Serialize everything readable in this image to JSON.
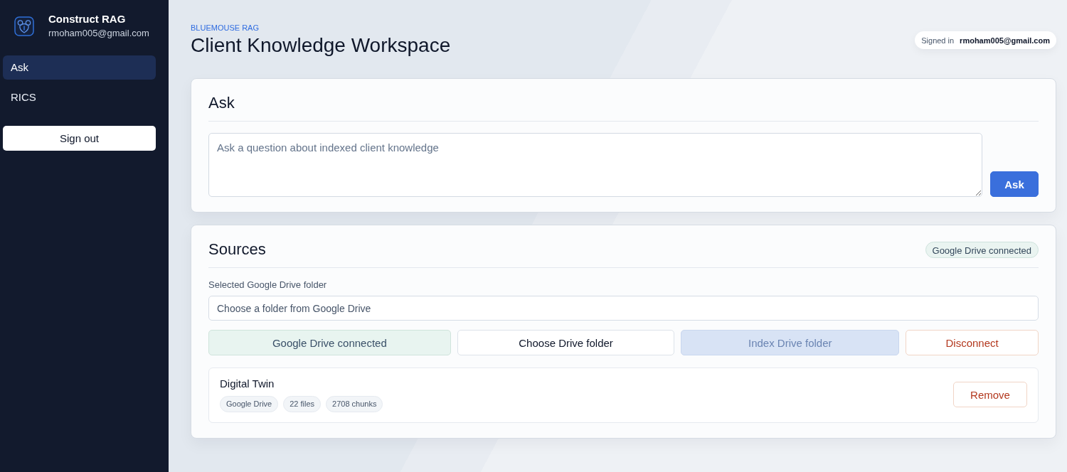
{
  "sidebar": {
    "app_name": "Construct RAG",
    "user_email": "rmoham005@gmail.com",
    "nav_items": [
      {
        "label": "Ask",
        "selected": true
      },
      {
        "label": "RICS",
        "selected": false
      }
    ],
    "sign_out_button": "Sign out"
  },
  "header": {
    "eyebrow": "BLUEMOUSE RAG",
    "title": "Client Knowledge Workspace",
    "signed_in": {
      "label": "Signed in",
      "email": "rmoham005@gmail.com"
    }
  },
  "ask_panel": {
    "title": "Ask",
    "question_field": {
      "placeholder": "Ask a question about indexed client knowledge"
    },
    "ask_button": {
      "label": "Ask",
      "kind": "primary",
      "disabled": false
    }
  },
  "sources_panel": {
    "title": "Sources",
    "status_badge": "Google Drive connected",
    "folder_field": {
      "label": "Selected Google Drive folder",
      "placeholder": "Choose a folder from Google Drive"
    },
    "actions": [
      {
        "label": "Google Drive connected",
        "kind": "success",
        "disabled": true
      },
      {
        "label": "Choose Drive folder",
        "kind": "default",
        "disabled": false
      },
      {
        "label": "Index Drive folder",
        "kind": "primary",
        "disabled": true
      },
      {
        "label": "Disconnect",
        "kind": "danger",
        "disabled": false
      }
    ],
    "sources": [
      {
        "name": "Digital Twin",
        "tags": [
          "Google Drive",
          "22 files",
          "2708 chunks"
        ],
        "remove_button": "Remove"
      }
    ]
  }
}
